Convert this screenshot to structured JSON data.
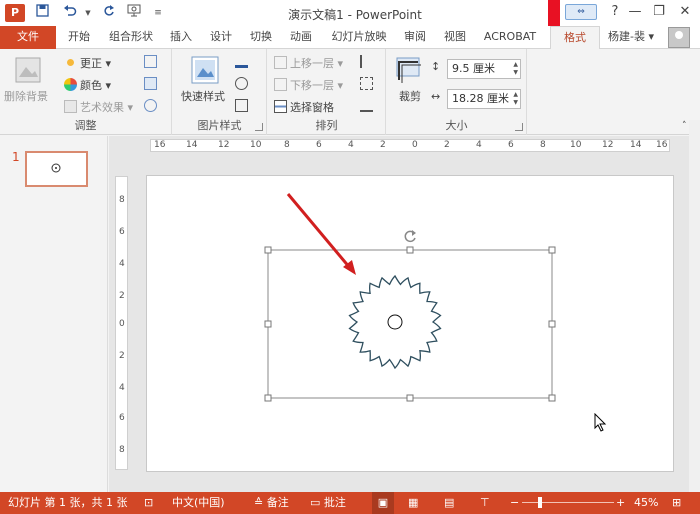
{
  "titlebar": {
    "app_icon": "P",
    "title": "演示文稿1 - PowerPoint",
    "minimize": "—",
    "restore": "❐",
    "close": "✕",
    "help": "?"
  },
  "tabs": [
    {
      "label": "文件"
    },
    {
      "label": "开始"
    },
    {
      "label": "组合形状"
    },
    {
      "label": "插入"
    },
    {
      "label": "设计"
    },
    {
      "label": "切换"
    },
    {
      "label": "动画"
    },
    {
      "label": "幻灯片放映"
    },
    {
      "label": "审阅"
    },
    {
      "label": "视图"
    },
    {
      "label": "ACROBAT"
    },
    {
      "label": "格式"
    }
  ],
  "user": {
    "name": "杨建-裴 ▾"
  },
  "ribbon": {
    "adjust": {
      "label": "调整",
      "remove_bg": "删除背景",
      "corrections": "更正 ▾",
      "color": "颜色 ▾",
      "artistic": "艺术效果 ▾"
    },
    "picture_styles": {
      "label": "图片样式",
      "quick_styles": "快速样式"
    },
    "arrange": {
      "label": "排列",
      "bring_forward": "上移一层 ▾",
      "send_backward": "下移一层 ▾",
      "selection_pane": "选择窗格"
    },
    "size": {
      "label": "大小",
      "crop": "裁剪",
      "height": "9.5 厘米",
      "width": "18.28 厘米"
    }
  },
  "thumbnails": [
    {
      "number": "1"
    }
  ],
  "rulers": {
    "horizontal": [
      "16",
      "14",
      "12",
      "10",
      "8",
      "6",
      "4",
      "2",
      "0",
      "2",
      "4",
      "6",
      "8",
      "10",
      "12",
      "14",
      "16"
    ],
    "vertical": [
      "8",
      "6",
      "4",
      "2",
      "0",
      "2",
      "4",
      "6",
      "8"
    ]
  },
  "statusbar": {
    "slide_info": "幻灯片 第 1 张，共 1 张",
    "language": "中文(中国)",
    "notes": "备注",
    "comments": "批注",
    "zoom": "45%",
    "zoom_level": 0.45
  },
  "colors": {
    "accent": "#d24726",
    "gear_stroke": "#2f4f5f",
    "arrow": "#d11f1f"
  }
}
